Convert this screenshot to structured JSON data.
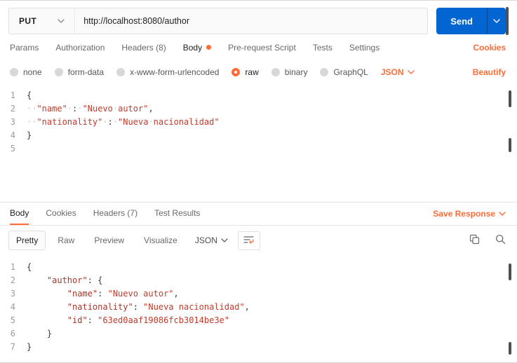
{
  "request": {
    "method": "PUT",
    "url": "http://localhost:8080/author",
    "send_label": "Send",
    "cookies_link": "Cookies",
    "tabs": [
      {
        "label": "Params"
      },
      {
        "label": "Authorization"
      },
      {
        "label": "Headers (8)"
      },
      {
        "label": "Body",
        "active": true,
        "dot": true
      },
      {
        "label": "Pre-request Script"
      },
      {
        "label": "Tests"
      },
      {
        "label": "Settings"
      }
    ],
    "body_modes": [
      {
        "label": "none"
      },
      {
        "label": "form-data"
      },
      {
        "label": "x-www-form-urlencoded"
      },
      {
        "label": "raw",
        "selected": true
      },
      {
        "label": "binary"
      },
      {
        "label": "GraphQL"
      }
    ],
    "language": "JSON",
    "beautify_link": "Beautify",
    "code": [
      {
        "num": 1,
        "segs": [
          {
            "c": "br",
            "t": "{"
          }
        ]
      },
      {
        "num": 2,
        "segs": [
          {
            "c": "ws",
            "t": "··"
          },
          {
            "c": "str",
            "t": "\"name\""
          },
          {
            "c": "ws",
            "t": "·"
          },
          {
            "c": "br",
            "t": ":"
          },
          {
            "c": "ws",
            "t": "·"
          },
          {
            "c": "str",
            "t": "\"Nuevo"
          },
          {
            "c": "ws",
            "t": "·"
          },
          {
            "c": "str",
            "t": "autor\""
          },
          {
            "c": "br",
            "t": ","
          }
        ]
      },
      {
        "num": 3,
        "segs": [
          {
            "c": "ws",
            "t": "··"
          },
          {
            "c": "str",
            "t": "\"nationality\""
          },
          {
            "c": "ws",
            "t": "·"
          },
          {
            "c": "br",
            "t": ":"
          },
          {
            "c": "ws",
            "t": "·"
          },
          {
            "c": "str",
            "t": "\"Nueva"
          },
          {
            "c": "ws",
            "t": "·"
          },
          {
            "c": "str",
            "t": "nacionalidad\""
          }
        ]
      },
      {
        "num": 4,
        "segs": [
          {
            "c": "br",
            "t": "}"
          }
        ]
      },
      {
        "num": 5,
        "segs": []
      }
    ]
  },
  "response": {
    "tabs": [
      {
        "label": "Body",
        "active": true
      },
      {
        "label": "Cookies"
      },
      {
        "label": "Headers (7)"
      },
      {
        "label": "Test Results"
      }
    ],
    "save_response": "Save Response",
    "view_tabs": [
      {
        "label": "Pretty",
        "active": true
      },
      {
        "label": "Raw"
      },
      {
        "label": "Preview"
      },
      {
        "label": "Visualize"
      }
    ],
    "language": "JSON",
    "code": [
      {
        "num": 1,
        "segs": [
          {
            "c": "br",
            "t": "{"
          }
        ]
      },
      {
        "num": 2,
        "segs": [
          {
            "c": "pl",
            "t": "    "
          },
          {
            "c": "key",
            "t": "\"author\""
          },
          {
            "c": "br",
            "t": ": {"
          }
        ]
      },
      {
        "num": 3,
        "segs": [
          {
            "c": "pl",
            "t": "        "
          },
          {
            "c": "key",
            "t": "\"name\""
          },
          {
            "c": "br",
            "t": ": "
          },
          {
            "c": "str",
            "t": "\"Nuevo autor\""
          },
          {
            "c": "br",
            "t": ","
          }
        ]
      },
      {
        "num": 4,
        "segs": [
          {
            "c": "pl",
            "t": "        "
          },
          {
            "c": "key",
            "t": "\"nationality\""
          },
          {
            "c": "br",
            "t": ": "
          },
          {
            "c": "str",
            "t": "\"Nueva nacionalidad\""
          },
          {
            "c": "br",
            "t": ","
          }
        ]
      },
      {
        "num": 5,
        "segs": [
          {
            "c": "pl",
            "t": "        "
          },
          {
            "c": "key",
            "t": "\"id\""
          },
          {
            "c": "br",
            "t": ": "
          },
          {
            "c": "str",
            "t": "\"63ed0aaf19086fcb3014be3e\""
          }
        ]
      },
      {
        "num": 6,
        "segs": [
          {
            "c": "pl",
            "t": "    "
          },
          {
            "c": "br",
            "t": "}"
          }
        ]
      },
      {
        "num": 7,
        "segs": [
          {
            "c": "br",
            "t": "}"
          }
        ]
      }
    ]
  },
  "icons": {
    "chevron_down": "⌄",
    "copy": "⧉",
    "search": "⌕",
    "text_wrap": "↵"
  },
  "colors": {
    "accent_orange": "#FF6C37",
    "send_blue": "#0265D2",
    "string_red": "#C13B2A",
    "key_red": "#A5382C"
  }
}
